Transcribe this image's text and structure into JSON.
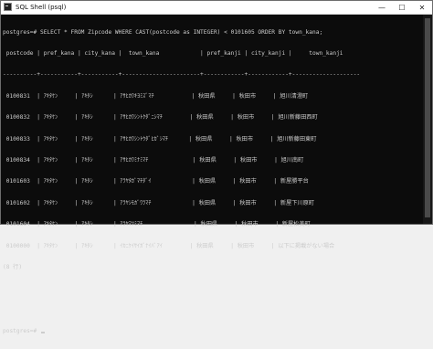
{
  "window": {
    "title": "SQL Shell (psql)",
    "minimize_glyph": "—",
    "maximize_glyph": "☐",
    "close_glyph": "✕",
    "icon": "terminal-icon"
  },
  "terminal": {
    "lines": [
      "postgres=# SELECT * FROM Zipcode WHERE CAST(postcode as INTEGER) < 0101605 ORDER BY town_kana;",
      " postcode | pref_kana | city_kana |  town_kana            | pref_kanji | city_kanji |     town_kanji",
      "----------+-----------+-----------+-----------------------+------------+------------+--------------------",
      " 0100831  | ｱｷﾀｹﾝ     | ｱｷﾀｼ      | ｱｻﾋｶﾜｷﾖﾐｽﾞﾏﾁ           | 秋田県     | 秋田市     | 旭川清澄町",
      " 0100832  | ｱｷﾀｹﾝ     | ｱｷﾀｼ      | ｱｻﾋｶﾜｼﾝﾄｸﾀﾞﾆｼﾏﾁ        | 秋田県     | 秋田市     | 旭川新藤田西町",
      " 0100833  | ｱｷﾀｹﾝ     | ｱｷﾀｼ      | ｱｻﾋｶﾜｼﾝﾄｳﾀﾞﾋｶﾞｼﾏﾁ      | 秋田県     | 秋田市     | 旭川新藤田東町",
      " 0100834  | ｱｷﾀｹﾝ     | ｱｷﾀｼ      | ｱｻﾋｶﾜﾐﾅﾐﾏﾁ             | 秋田県     | 秋田市     | 旭川南町",
      " 0101603  | ｱｷﾀｹﾝ     | ｱｷﾀｼ      | ｱﾗﾔﾀｶﾞﾏﾁﾀﾞｲ            | 秋田県     | 秋田市     | 新屋勝平台",
      " 0101602  | ｱｷﾀｹﾝ     | ｱｷﾀｼ      | ｱﾗﾔｼﾓｶﾞﾜﾗﾏﾁ            | 秋田県     | 秋田市     | 新屋下川原町",
      " 0101604  | ｱｷﾀｹﾝ     | ｱｷﾀｼ      | ｱﾗﾔﾏﾂﾐﾏﾁ               | 秋田県     | 秋田市     | 新屋松美町",
      " 0100000  | ｱｷﾀｹﾝ     | ｱｷﾀｼ      | ｲｶﾆｹｲｻｲｶﾞﾅｲﾊﾞｱｲ        | 秋田県     | 秋田市     | 以下に掲載がない場合",
      "(8 行)",
      "",
      "",
      "postgres=# "
    ]
  }
}
